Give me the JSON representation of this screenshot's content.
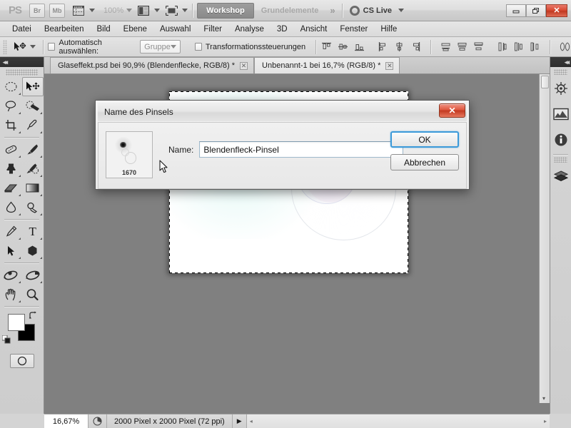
{
  "app": {
    "name": "Adobe Photoshop CS5",
    "logo": "PS"
  },
  "appbar": {
    "bridge_label": "Br",
    "minibridge_label": "Mb",
    "extras_icon": "view-extras-icon",
    "zoom_value": "100%",
    "arrange_icon": "arrange-documents-icon",
    "screenmode_icon": "screen-mode-icon",
    "workspaces": [
      {
        "label": "Workshop",
        "active": true
      },
      {
        "label": "Grundelemente",
        "active": false
      }
    ],
    "more_workspaces": "»",
    "cslive_label": "CS Live",
    "window_buttons": {
      "minimize": "–",
      "restore": "❐",
      "close": "✕"
    }
  },
  "menubar": {
    "items": [
      "Datei",
      "Bearbeiten",
      "Bild",
      "Ebene",
      "Auswahl",
      "Filter",
      "Analyse",
      "3D",
      "Ansicht",
      "Fenster",
      "Hilfe"
    ]
  },
  "optionsbar": {
    "tool_icon": "move-tool-icon",
    "auto_select_label": "Automatisch auswählen:",
    "auto_select_checked": false,
    "auto_select_scope": "Gruppe",
    "transform_controls_label": "Transformationssteuerungen",
    "transform_controls_checked": false,
    "align_icons": [
      "align-top-edges-icon",
      "align-vertical-centers-icon",
      "align-bottom-edges-icon",
      "align-left-edges-icon",
      "align-horizontal-centers-icon",
      "align-right-edges-icon",
      "distribute-top-edges-icon",
      "distribute-vertical-centers-icon",
      "distribute-bottom-edges-icon",
      "distribute-left-edges-icon",
      "distribute-horizontal-centers-icon",
      "distribute-right-edges-icon",
      "auto-align-layers-icon"
    ]
  },
  "tabs": [
    {
      "label": "Glaseffekt.psd bei 90,9% (Blendenflecke, RGB/8) *",
      "active": false,
      "close": "✕"
    },
    {
      "label": "Unbenannt-1 bei 16,7% (RGB/8) *",
      "active": true,
      "close": "✕"
    }
  ],
  "toolbar": {
    "collapse_icon": "collapse-panel-icon",
    "tools": [
      {
        "name": "marquee-tool",
        "selected": false
      },
      {
        "name": "move-tool",
        "selected": true
      },
      {
        "name": "lasso-tool",
        "selected": false
      },
      {
        "name": "quick-selection-tool",
        "selected": false
      },
      {
        "name": "crop-tool",
        "selected": false
      },
      {
        "name": "eyedropper-tool",
        "selected": false
      },
      {
        "name": "healing-brush-tool",
        "selected": false
      },
      {
        "name": "brush-tool",
        "selected": false
      },
      {
        "name": "clone-stamp-tool",
        "selected": false
      },
      {
        "name": "history-brush-tool",
        "selected": false
      },
      {
        "name": "eraser-tool",
        "selected": false
      },
      {
        "name": "gradient-tool",
        "selected": false
      },
      {
        "name": "blur-tool",
        "selected": false
      },
      {
        "name": "dodge-tool",
        "selected": false
      },
      {
        "name": "pen-tool",
        "selected": false
      },
      {
        "name": "type-tool",
        "selected": false
      },
      {
        "name": "path-selection-tool",
        "selected": false
      },
      {
        "name": "shape-tool",
        "selected": false
      },
      {
        "name": "3d-rotate-tool",
        "selected": false
      },
      {
        "name": "3d-orbit-tool",
        "selected": false
      },
      {
        "name": "hand-tool",
        "selected": false
      },
      {
        "name": "zoom-tool",
        "selected": false
      }
    ],
    "foreground_color": "#ffffff",
    "background_color": "#000000",
    "swap_colors_icon": "swap-colors-icon",
    "default_colors_icon": "default-colors-icon",
    "quickmask_icon": "quick-mask-icon"
  },
  "rightdock": {
    "collapse_icon": "collapse-panel-icon",
    "panels": [
      {
        "name": "adjustments-panel-icon"
      },
      {
        "name": "masks-panel-icon"
      },
      {
        "name": "info-panel-icon"
      },
      {
        "name": "layers-panel-icon"
      }
    ]
  },
  "document": {
    "canvas_background": "#ffffff",
    "workspace_background": "#808080",
    "selection": "marching-ants-selection"
  },
  "statusbar": {
    "zoom": "16,67%",
    "proxy_icon": "document-proxy-icon",
    "info": "2000 Pixel x 2000 Pixel (72 ppi)",
    "expand_arrow": "▶",
    "scroll_left": "◂",
    "scroll_right": "▸"
  },
  "dialog": {
    "title": "Name des Pinsels",
    "close_label": "✕",
    "thumbnail_number": "1670",
    "name_label": "Name:",
    "name_value": "Blendenfleck-Pinsel",
    "name_placeholder": "",
    "ok_label": "OK",
    "cancel_label": "Abbrechen",
    "cursor": "arrow-cursor"
  },
  "colors": {
    "accent_blue": "#3c9ad9",
    "close_red": "#c33a21",
    "workspace_gray": "#808080",
    "chrome_gray": "#d6d6d6",
    "flare_cyan": "#61c5ba"
  }
}
